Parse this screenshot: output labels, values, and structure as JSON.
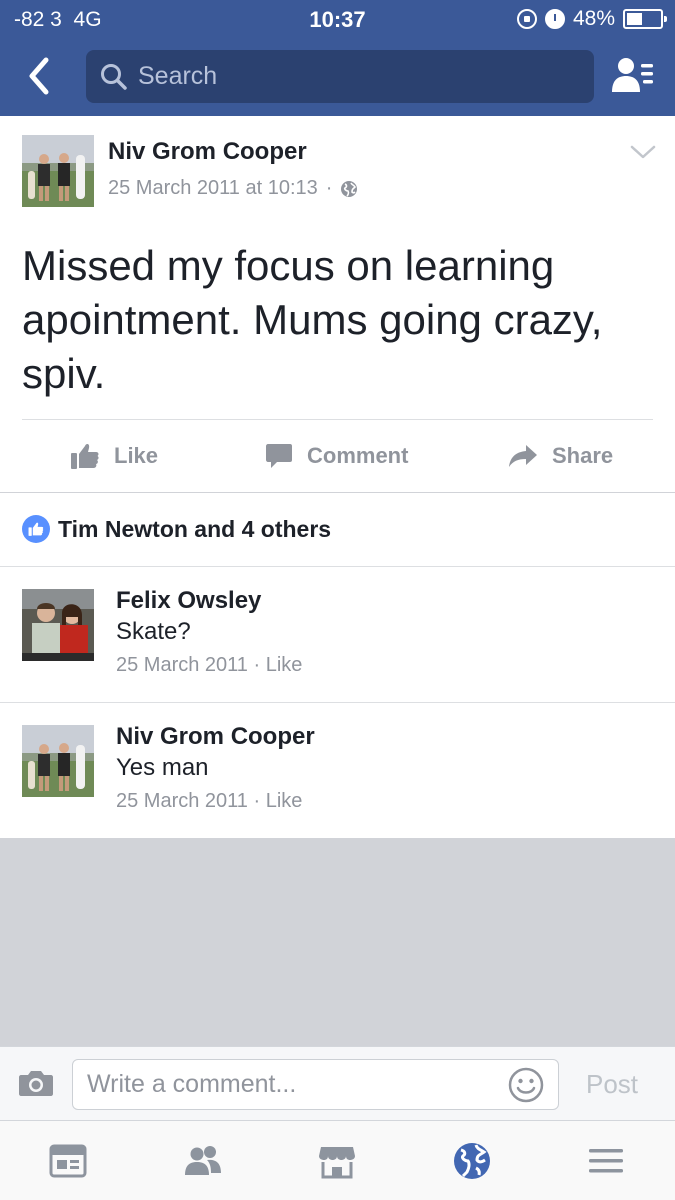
{
  "status_bar": {
    "signal": "-82 3",
    "network": "4G",
    "time": "10:37",
    "battery_percent": "48%",
    "battery_level": 0.48,
    "icons": [
      "orientation-lock-icon",
      "alarm-icon",
      "battery-icon"
    ]
  },
  "header": {
    "search_placeholder": "Search",
    "icons": [
      "back-arrow-icon",
      "search-icon",
      "friend-requests-icon"
    ]
  },
  "post": {
    "author": "Niv Grom Cooper",
    "timestamp": "25 March 2011 at 10:13",
    "separator": "·",
    "privacy_icon": "globe-icon",
    "text": "Missed my focus on learning apointment. Mums going crazy, spiv.",
    "actions": {
      "like": "Like",
      "comment": "Comment",
      "share": "Share"
    }
  },
  "likes_summary": {
    "text": "Tim Newton and 4 others",
    "icon": "like-badge-icon"
  },
  "comments": [
    {
      "author": "Felix Owsley",
      "text": "Skate?",
      "date": "25 March 2011",
      "separator": " · ",
      "like_label": "Like"
    },
    {
      "author": "Niv Grom Cooper",
      "text": "Yes man",
      "date": "25 March 2011",
      "separator": " · ",
      "like_label": "Like"
    }
  ],
  "composer": {
    "placeholder": "Write a comment...",
    "post_label": "Post",
    "icons": [
      "camera-icon",
      "emoji-icon"
    ]
  },
  "tabbar": {
    "tabs": [
      "news-feed-icon",
      "friends-icon",
      "marketplace-icon",
      "notifications-globe-icon",
      "menu-icon"
    ],
    "active": "notifications-globe-icon"
  },
  "colors": {
    "brand": "#3b5998",
    "search_bg": "#2b4170",
    "text": "#1d2129",
    "muted": "#90949c",
    "like_blue": "#5890ff",
    "active_tab": "#4267b2",
    "inactive_tab": "#8d949e",
    "gray_area": "#d1d3d8"
  }
}
